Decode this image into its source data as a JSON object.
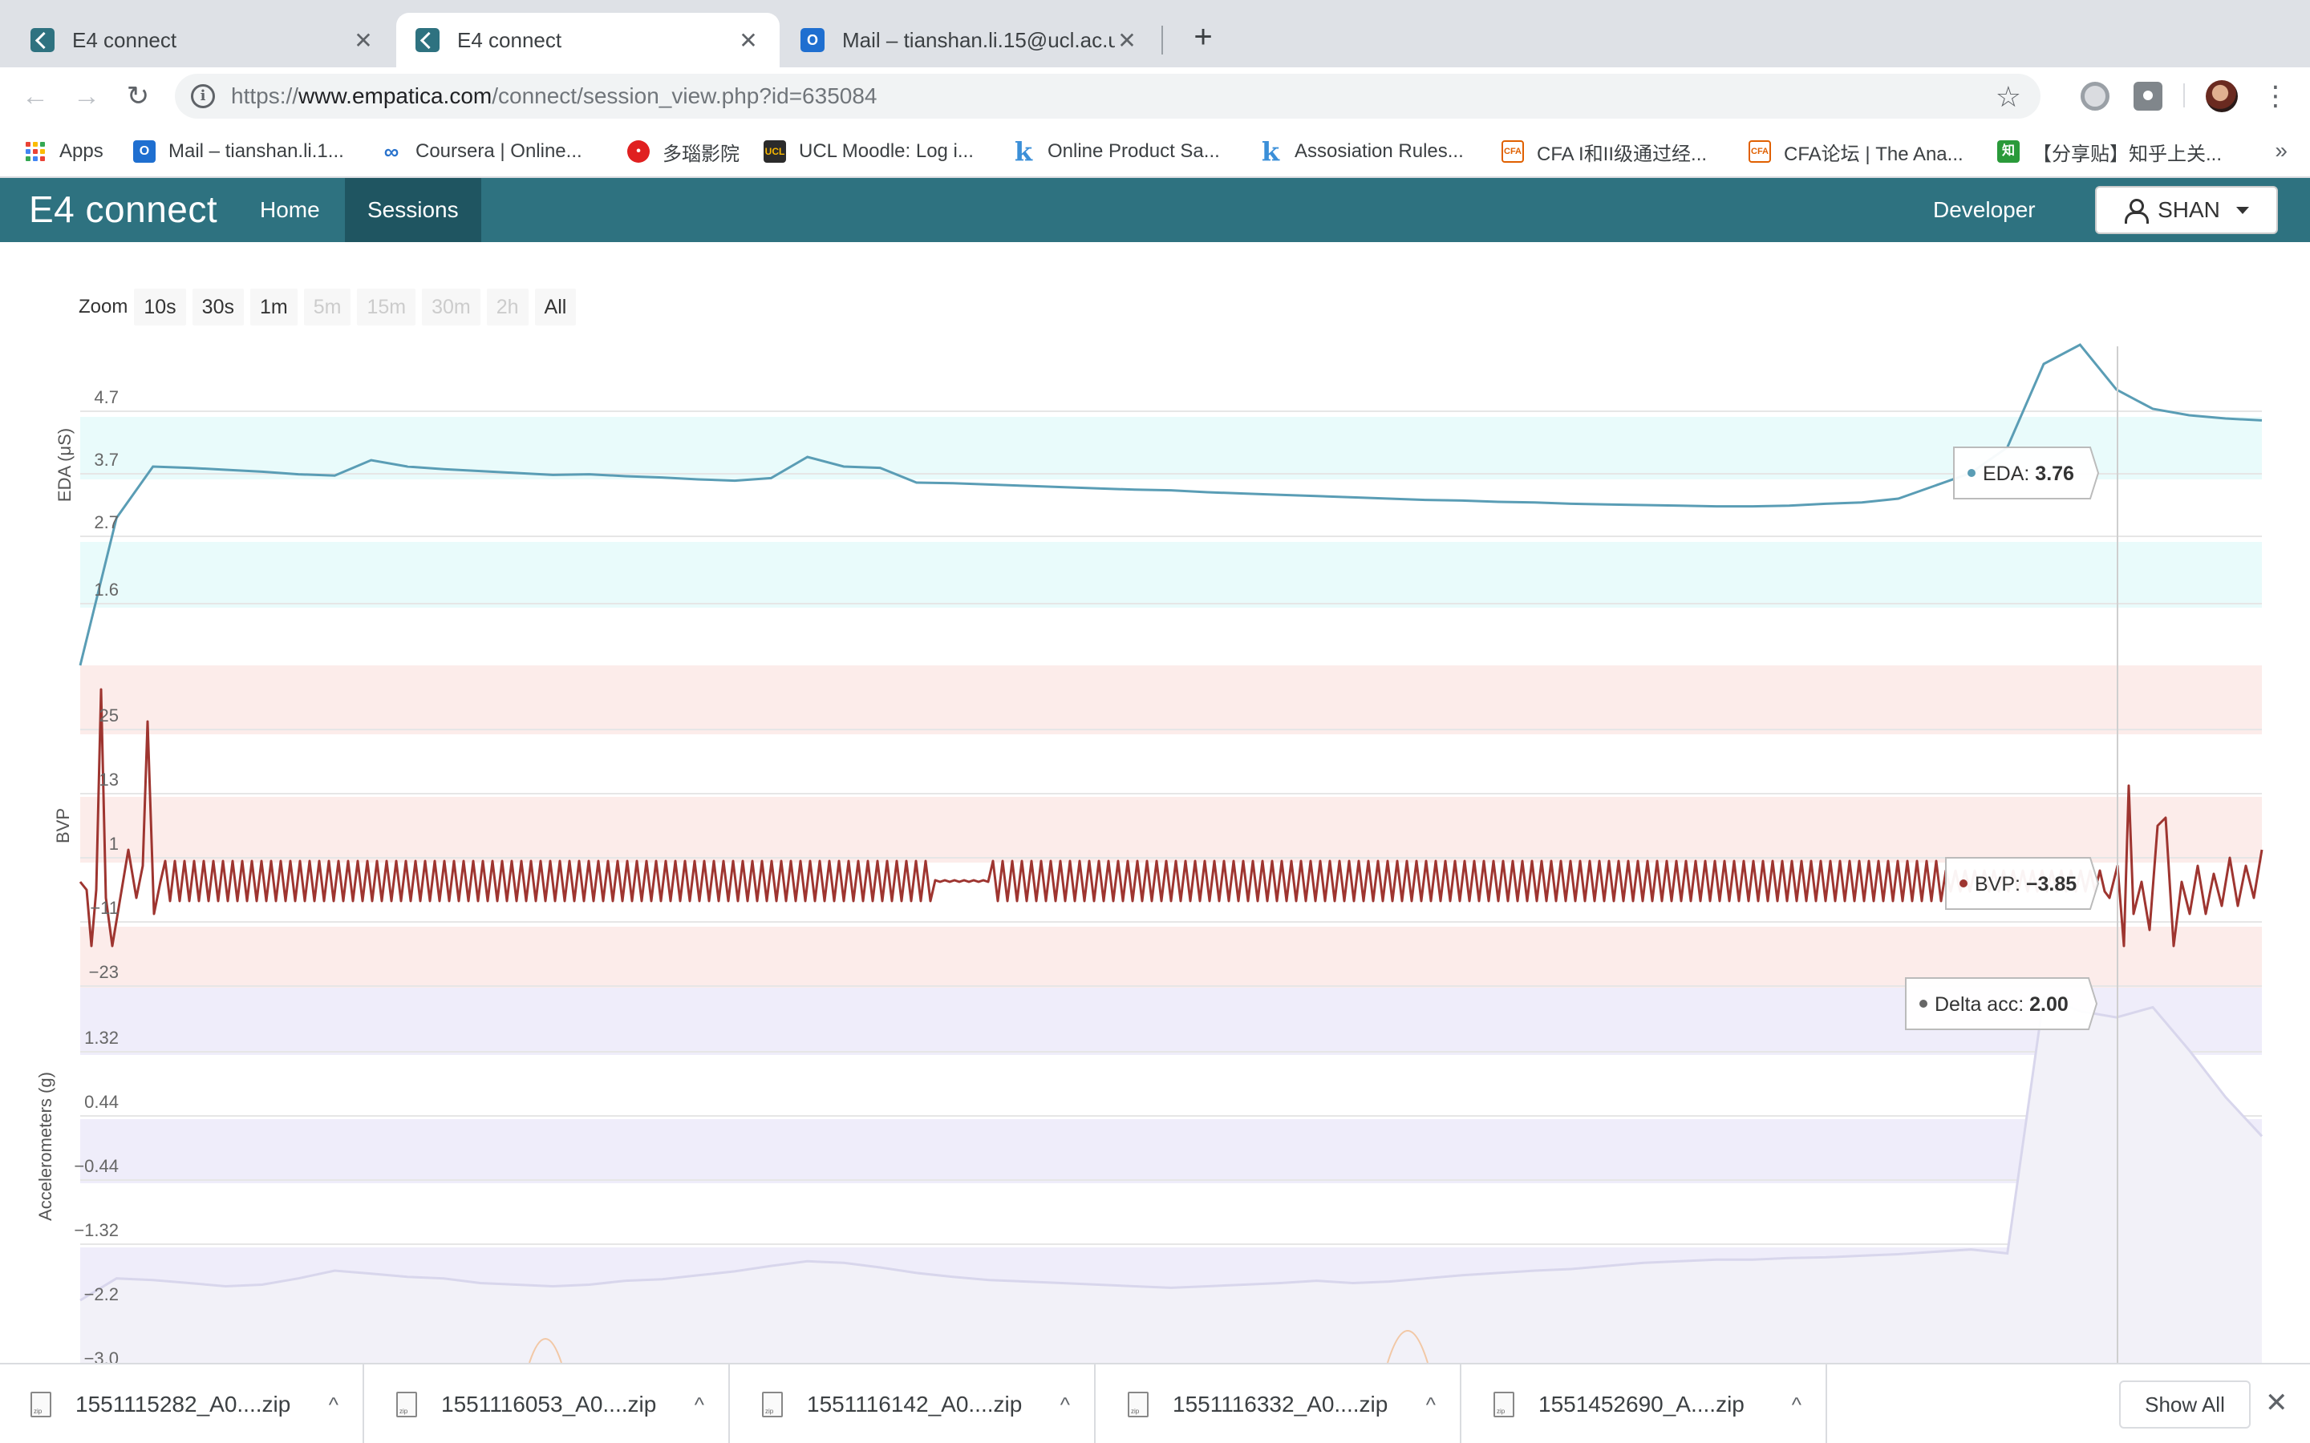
{
  "browser": {
    "tabs": [
      {
        "title": "E4 connect",
        "active": false
      },
      {
        "title": "E4 connect",
        "active": true
      },
      {
        "title": "Mail – tianshan.li.15@ucl.ac.uk",
        "active": false
      }
    ],
    "new_tab": "+",
    "url_scheme": "https://",
    "url_host": "www.empatica.com",
    "url_path": "/connect/session_view.php?id=635084",
    "bookmarks": [
      {
        "label": "Apps",
        "icon": "apps-grid-icon"
      },
      {
        "label": "Mail – tianshan.li.1...",
        "icon": "outlook-icon"
      },
      {
        "label": "Coursera | Online...",
        "icon": "coursera-icon"
      },
      {
        "label": "多瑙影院",
        "icon": "duonao-icon"
      },
      {
        "label": "UCL Moodle: Log i...",
        "icon": "ucl-icon"
      },
      {
        "label": "Online Product Sa...",
        "icon": "k-icon"
      },
      {
        "label": "Assosiation Rules...",
        "icon": "k-icon"
      },
      {
        "label": "CFA I和II级通过经...",
        "icon": "cfa-icon"
      },
      {
        "label": "CFA论坛 | The Ana...",
        "icon": "cfa-icon"
      },
      {
        "label": "【分享贴】知乎上关...",
        "icon": "zhihu-icon"
      }
    ],
    "bookmarks_more": "»"
  },
  "app": {
    "brand": "E4 connect",
    "nav": [
      {
        "label": "Home",
        "active": false
      },
      {
        "label": "Sessions",
        "active": true
      }
    ],
    "developer": "Developer",
    "user": "SHAN",
    "accent_color": "#2e7280"
  },
  "zoom": {
    "label": "Zoom",
    "buttons": [
      {
        "label": "10s",
        "enabled": true
      },
      {
        "label": "30s",
        "enabled": true
      },
      {
        "label": "1m",
        "enabled": true
      },
      {
        "label": "5m",
        "enabled": false
      },
      {
        "label": "15m",
        "enabled": false
      },
      {
        "label": "30m",
        "enabled": false
      },
      {
        "label": "2h",
        "enabled": false
      },
      {
        "label": "All",
        "enabled": true
      }
    ]
  },
  "chart_data": [
    {
      "type": "line",
      "ylabel": "EDA (μS)",
      "yticks": [
        "4.7",
        "3.7",
        "2.7",
        "1.6"
      ],
      "color": "#5a9db5",
      "band_color": "#e9fbfb",
      "tooltip": {
        "label": "EDA:",
        "value": "3.76"
      },
      "series": [
        {
          "values": [
            0.6,
            2.9,
            3.7,
            3.68,
            3.65,
            3.62,
            3.58,
            3.56,
            3.8,
            3.7,
            3.66,
            3.63,
            3.6,
            3.57,
            3.58,
            3.55,
            3.53,
            3.5,
            3.48,
            3.52,
            3.85,
            3.7,
            3.68,
            3.45,
            3.44,
            3.42,
            3.4,
            3.38,
            3.36,
            3.34,
            3.33,
            3.3,
            3.28,
            3.26,
            3.24,
            3.22,
            3.2,
            3.18,
            3.17,
            3.15,
            3.14,
            3.12,
            3.11,
            3.1,
            3.09,
            3.08,
            3.08,
            3.09,
            3.12,
            3.14,
            3.2,
            3.4,
            3.6,
            4.0,
            5.3,
            5.6,
            4.9,
            4.6,
            4.5,
            4.45,
            4.42
          ]
        }
      ]
    },
    {
      "type": "line",
      "ylabel": "BVP",
      "yticks": [
        "25",
        "13",
        "1",
        "-11",
        "-23"
      ],
      "color": "#9e3530",
      "band_color": "#fcecea",
      "tooltip": {
        "label": "BVP:",
        "value": "-3.85"
      }
    },
    {
      "type": "area",
      "ylabel": "Accelerometers (g)",
      "yticks": [
        "1.32",
        "0.44",
        "-0.44",
        "-1.32",
        "-2.2",
        "-3.0"
      ],
      "color": "#d8d6ec",
      "band_color": "#efedfa",
      "band_color_2": "#fdefe3",
      "tooltip": {
        "label": "Delta acc:",
        "value": "2.00"
      },
      "series": [
        {
          "values": [
            -1.9,
            -1.62,
            -1.64,
            -1.68,
            -1.72,
            -1.7,
            -1.62,
            -1.52,
            -1.56,
            -1.6,
            -1.62,
            -1.68,
            -1.7,
            -1.72,
            -1.7,
            -1.65,
            -1.63,
            -1.58,
            -1.53,
            -1.46,
            -1.4,
            -1.42,
            -1.48,
            -1.55,
            -1.6,
            -1.64,
            -1.66,
            -1.68,
            -1.7,
            -1.72,
            -1.74,
            -1.72,
            -1.7,
            -1.68,
            -1.65,
            -1.68,
            -1.66,
            -1.62,
            -1.58,
            -1.55,
            -1.52,
            -1.5,
            -1.46,
            -1.42,
            -1.4,
            -1.38,
            -1.38,
            -1.36,
            -1.35,
            -1.33,
            -1.31,
            -1.28,
            -1.25,
            -1.3,
            1.98,
            1.8,
            1.72,
            1.85,
            1.3,
            0.7,
            0.2
          ]
        }
      ]
    }
  ],
  "downloads": {
    "items": [
      "1551115282_A0....zip",
      "1551116053_A0....zip",
      "1551116142_A0....zip",
      "1551116332_A0....zip",
      "1551452690_A....zip"
    ],
    "show_all": "Show All"
  }
}
